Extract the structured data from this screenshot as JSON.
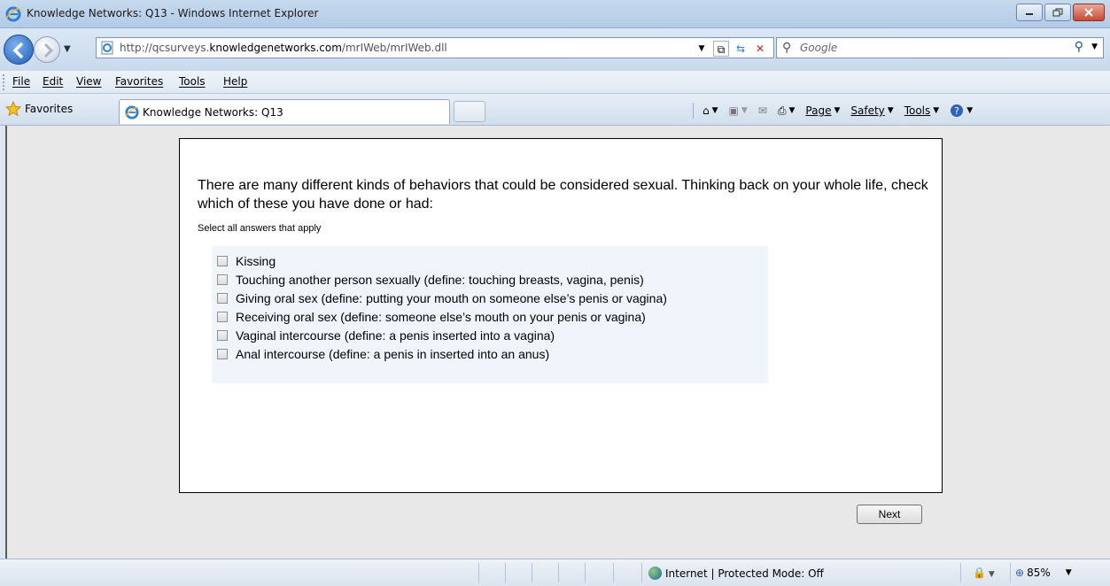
{
  "window": {
    "title": "Knowledge Networks: Q13 - Windows Internet Explorer"
  },
  "address_bar": {
    "url_prefix": "http://qcsurveys.",
    "url_domain": "knowledgenetworks.com",
    "url_suffix": "/mrIWeb/mrIWeb.dll",
    "search_placeholder": "Google"
  },
  "menu": {
    "items": [
      "File",
      "Edit",
      "View",
      "Favorites",
      "Tools",
      "Help"
    ]
  },
  "favorites_bar": {
    "favorites_label": "Favorites",
    "tab_label": "Knowledge Networks: Q13",
    "commands": [
      "Page",
      "Safety",
      "Tools"
    ]
  },
  "survey": {
    "question": "There are many different kinds of behaviors that could be considered sexual. Thinking back on your whole life, check which of these you have done or had:",
    "instruction": "Select all answers that apply",
    "answers": [
      "Kissing",
      "Touching another person sexually (define: touching breasts, vagina, penis)",
      "Giving oral sex (define: putting your mouth on someone else’s penis or vagina)",
      "Receiving oral sex (define: someone else’s mouth on your penis or vagina)",
      "Vaginal intercourse (define: a penis inserted into a vagina)",
      "Anal intercourse (define: a penis in inserted into an anus)"
    ],
    "next_label": "Next"
  },
  "status_bar": {
    "zone_text": "Internet | Protected Mode: Off",
    "zoom": "85%"
  },
  "colors": {
    "answer_background": "#eff5fb",
    "content_background": "#e8e8e8"
  }
}
